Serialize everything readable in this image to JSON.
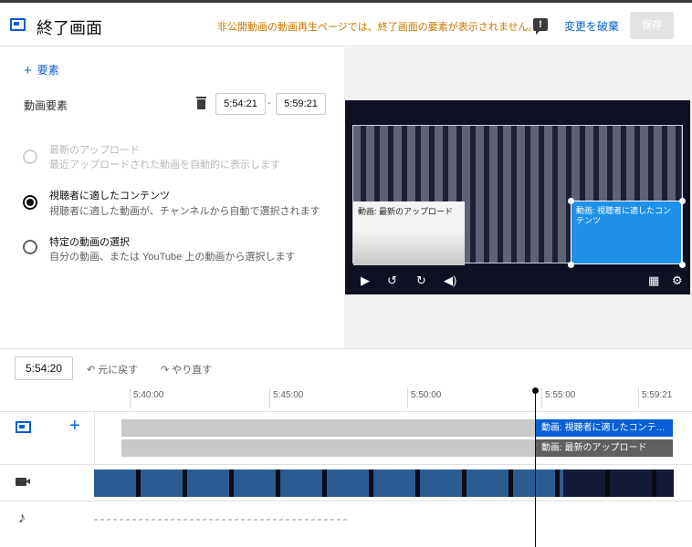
{
  "header": {
    "title": "終了画面",
    "warning": "非公開動画の動画再生ページでは、終了画面の要素が表示されません。",
    "discard_label": "変更を破棄",
    "save_label": "保存"
  },
  "editor": {
    "add_element_label": "要素",
    "element_label": "動画要素",
    "start_time": "5:54:21",
    "end_time": "5:59:21",
    "options": [
      {
        "title": "最新のアップロード",
        "desc": "最近アップロードされた動画を自動的に表示します",
        "state": "disabled"
      },
      {
        "title": "視聴者に適したコンテンツ",
        "desc": "視聴者に適した動画が、チャンネルから自動で選択されます",
        "state": "checked"
      },
      {
        "title": "特定の動画の選択",
        "desc": "自分の動画、または YouTube 上の動画から選択します",
        "state": "unchecked"
      }
    ]
  },
  "preview": {
    "card_latest": "動画: 最新のアップロード",
    "card_suggested": "動画: 視聴者に適したコンテンツ"
  },
  "timeline": {
    "current_time": "5:54:20",
    "undo_label": "元に戻す",
    "redo_label": "やり直す",
    "ticks": [
      "5:40:00",
      "5:45:00",
      "5:50:00",
      "5:55:00",
      "5:59:21"
    ],
    "bar_suggested": "動画: 視聴者に適したコンテ…",
    "bar_latest": "動画: 最新のアップロード"
  }
}
